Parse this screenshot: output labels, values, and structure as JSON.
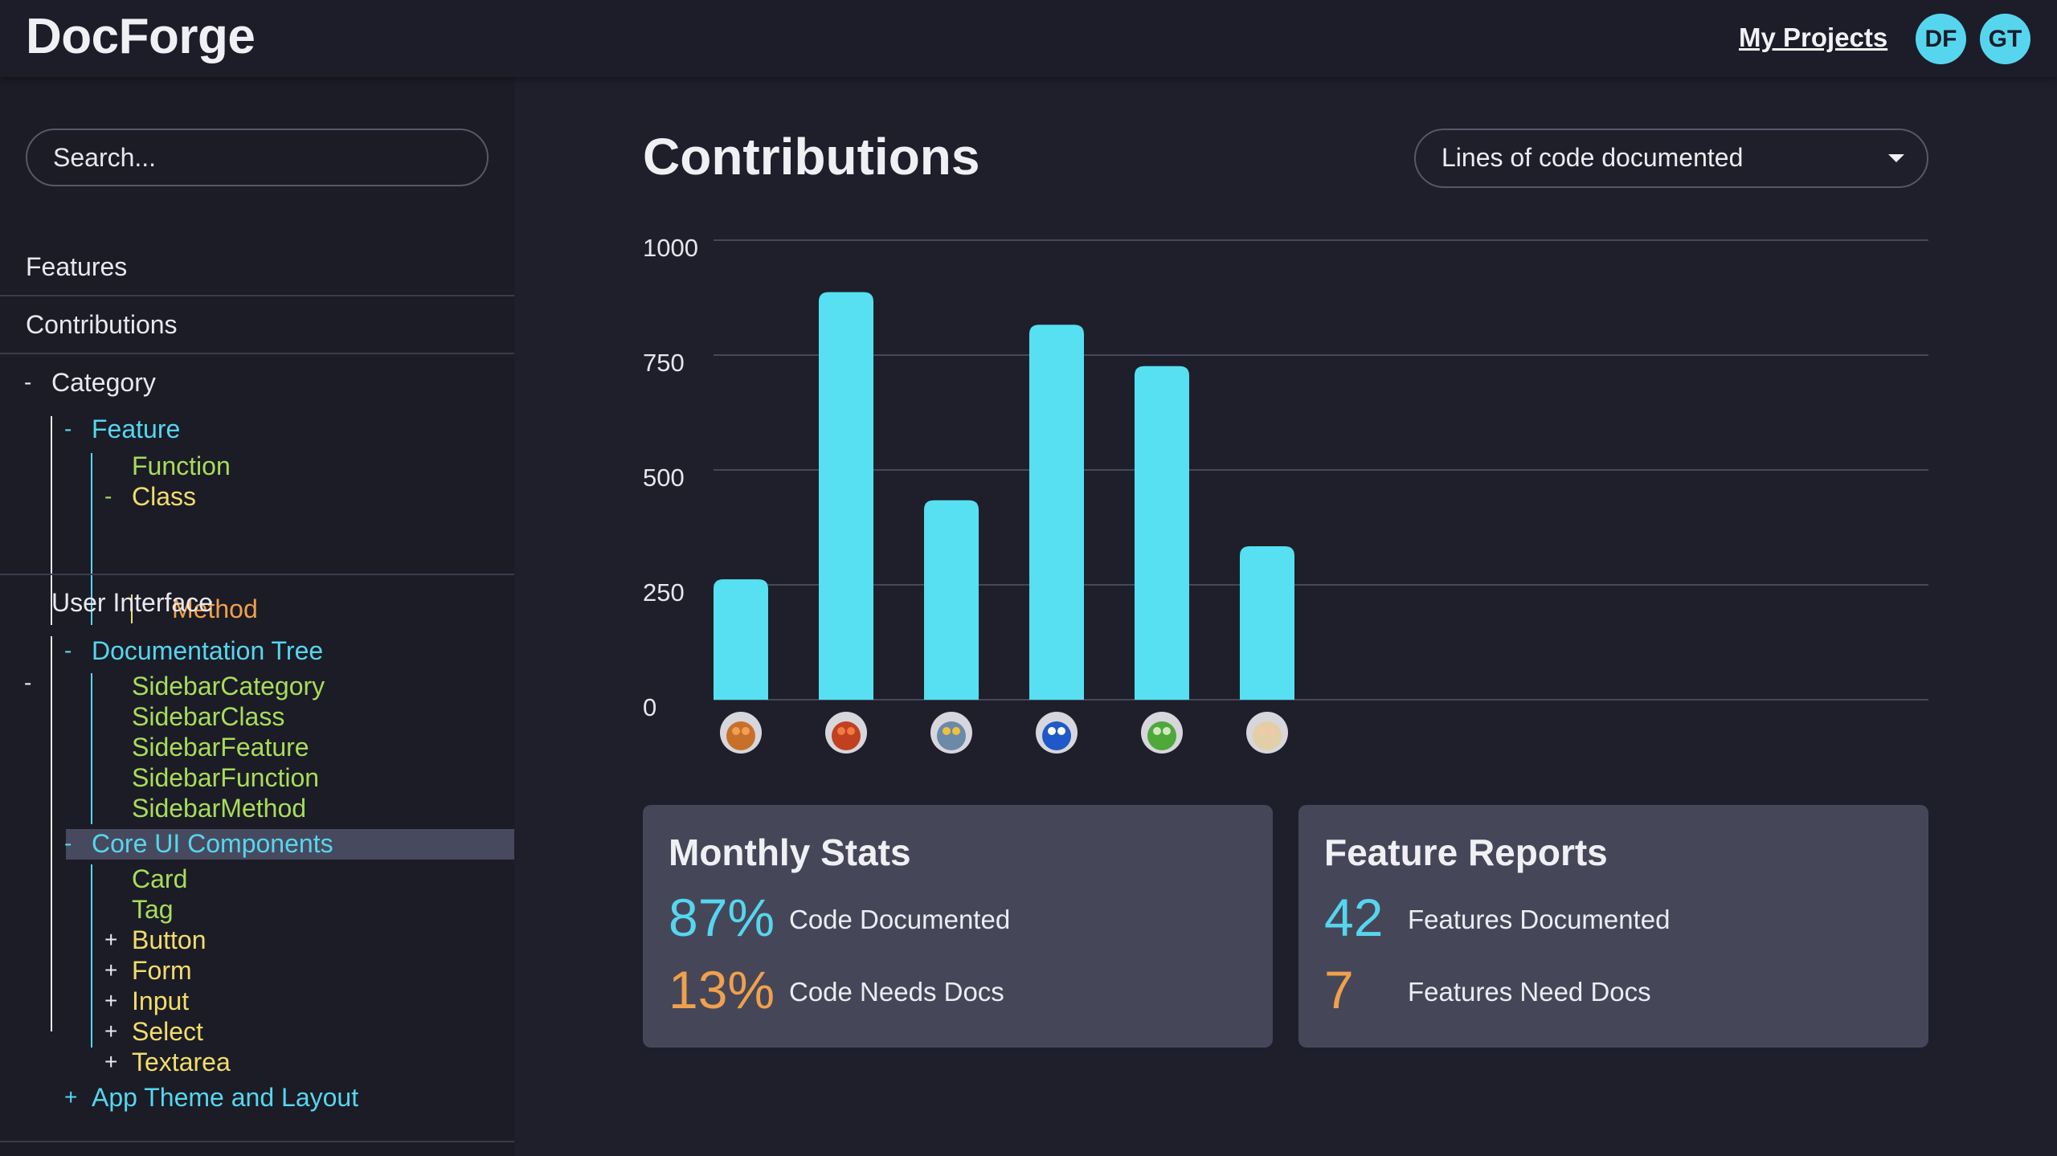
{
  "app": {
    "name": "DocForge"
  },
  "header": {
    "projects_link": "My Projects",
    "users": [
      {
        "initials": "DF"
      },
      {
        "initials": "GT"
      }
    ]
  },
  "sidebar": {
    "search_placeholder": "Search...",
    "nav": [
      {
        "label": "Features"
      },
      {
        "label": "Contributions"
      }
    ],
    "tree": {
      "category": {
        "toggle": "-",
        "label": "Category",
        "feature": {
          "toggle": "-",
          "label": "Feature",
          "function_label": "Function",
          "class": {
            "toggle": "-",
            "label": "Class",
            "method_label": "Method"
          }
        }
      },
      "ui": {
        "toggle": "-",
        "label": "User Interface",
        "doc_tree": {
          "toggle": "-",
          "label": "Documentation Tree",
          "items": [
            {
              "label": "SidebarCategory"
            },
            {
              "label": "SidebarClass"
            },
            {
              "label": "SidebarFeature"
            },
            {
              "label": "SidebarFunction"
            },
            {
              "label": "SidebarMethod"
            }
          ]
        },
        "core": {
          "toggle": "-",
          "label": "Core UI Components",
          "items": [
            {
              "label": "Card"
            },
            {
              "label": "Tag"
            }
          ],
          "collapsed": [
            {
              "toggle": "+",
              "label": "Button"
            },
            {
              "toggle": "+",
              "label": "Form"
            },
            {
              "toggle": "+",
              "label": "Input"
            },
            {
              "toggle": "+",
              "label": "Select"
            },
            {
              "toggle": "+",
              "label": "Textarea"
            }
          ]
        },
        "theme": {
          "toggle": "+",
          "label": "App Theme and Layout"
        }
      }
    }
  },
  "main": {
    "title": "Contributions",
    "metric_select": {
      "value": "Lines of code documented"
    }
  },
  "chart_data": {
    "type": "bar",
    "categories": [
      "contributor-1",
      "contributor-2",
      "contributor-3",
      "contributor-4",
      "contributor-5",
      "contributor-6"
    ],
    "values": [
      262,
      887,
      434,
      816,
      726,
      334
    ],
    "ylim": [
      0,
      1000
    ],
    "yticks": [
      "0",
      "250",
      "500",
      "750",
      "1000"
    ],
    "grid": true,
    "bar_color": "#56e0f2",
    "x_tick_avatars": [
      "orange-puppet-avatar",
      "red-haired-puppet-avatar",
      "blue-bird-puppet-avatar",
      "blue-monster-puppet-avatar",
      "green-frog-puppet-avatar",
      "blonde-pig-puppet-avatar"
    ]
  },
  "stats": {
    "monthly": {
      "title": "Monthly Stats",
      "rows": [
        {
          "value": "87%",
          "label": "Code Documented"
        },
        {
          "value": "13%",
          "label": "Code Needs Docs"
        }
      ]
    },
    "features": {
      "title": "Feature Reports",
      "rows": [
        {
          "value": "42",
          "label": "Features Documented"
        },
        {
          "value": "7",
          "label": "Features Need Docs"
        }
      ]
    }
  },
  "colors": {
    "accent": "#56d6ee",
    "positive": "#56d6ee",
    "negative": "#f1a04c",
    "tree_level2": "#a9dc5a",
    "tree_level3": "#f2dc6c",
    "tree_level4": "#f1a04c"
  }
}
